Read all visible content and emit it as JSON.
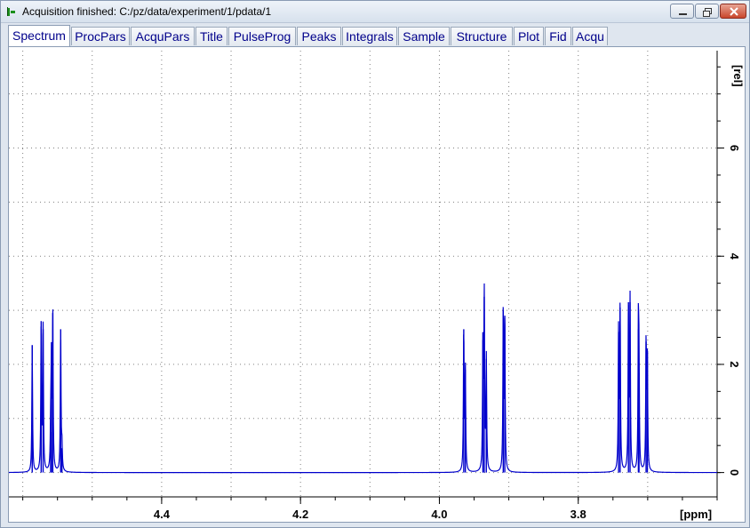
{
  "window": {
    "title": "Acquisition finished: C:/pz/data/experiment/1/pdata/1",
    "controls": {
      "minimize": "minimize-icon",
      "maximize": "restore-icon",
      "close": "close-icon"
    }
  },
  "tabs": [
    {
      "label": "Spectrum",
      "active": true
    },
    {
      "label": "ProcPars",
      "active": false
    },
    {
      "label": "AcquPars",
      "active": false
    },
    {
      "label": "Title",
      "active": false
    },
    {
      "label": "PulseProg",
      "active": false
    },
    {
      "label": "Peaks",
      "active": false
    },
    {
      "label": "Integrals",
      "active": false
    },
    {
      "label": "Sample",
      "active": false
    },
    {
      "label": "Structure",
      "active": false
    },
    {
      "label": "Plot",
      "active": false
    },
    {
      "label": "Fid",
      "active": false
    },
    {
      "label": "Acqu",
      "active": false
    }
  ],
  "colors": {
    "spectrum": "#0000cc",
    "grid": "#808080",
    "tab_text": "#00008b"
  },
  "chart_data": {
    "type": "line",
    "xlabel": "[ppm]",
    "ylabel": "[rel]",
    "x_reversed": true,
    "xlim": [
      4.62,
      3.6
    ],
    "ylim": [
      -0.45,
      7.8
    ],
    "x_ticks": [
      "4.4",
      "4.2",
      "4.0",
      "3.8"
    ],
    "x_tick_values": [
      4.4,
      4.2,
      4.0,
      3.8
    ],
    "y_ticks": [
      "0",
      "2",
      "4",
      "6"
    ],
    "y_tick_values": [
      0,
      2,
      4,
      6
    ],
    "grid": true,
    "peaks": [
      {
        "ppm": 4.5864,
        "height": 2.35
      },
      {
        "ppm": 4.5735,
        "height": 2.8
      },
      {
        "ppm": 4.5707,
        "height": 2.65
      },
      {
        "ppm": 4.5598,
        "height": 0.75
      },
      {
        "ppm": 4.5588,
        "height": 1.95
      },
      {
        "ppm": 4.5568,
        "height": 2.95
      },
      {
        "ppm": 4.5454,
        "height": 2.65
      },
      {
        "ppm": 4.5436,
        "height": 0.45
      },
      {
        "ppm": 3.9649,
        "height": 2.65
      },
      {
        "ppm": 3.9626,
        "height": 1.9
      },
      {
        "ppm": 3.9373,
        "height": 2.45
      },
      {
        "ppm": 3.9354,
        "height": 3.25
      },
      {
        "ppm": 3.9324,
        "height": 2.1
      },
      {
        "ppm": 3.908,
        "height": 3.0
      },
      {
        "ppm": 3.9058,
        "height": 2.9
      },
      {
        "ppm": 3.7419,
        "height": 2.6
      },
      {
        "ppm": 3.7397,
        "height": 3.05
      },
      {
        "ppm": 3.7277,
        "height": 3.15
      },
      {
        "ppm": 3.7254,
        "height": 3.15
      },
      {
        "ppm": 3.7134,
        "height": 2.65
      },
      {
        "ppm": 3.7125,
        "height": 1.8
      },
      {
        "ppm": 3.7023,
        "height": 2.42
      },
      {
        "ppm": 3.7005,
        "height": 2.25
      }
    ]
  }
}
